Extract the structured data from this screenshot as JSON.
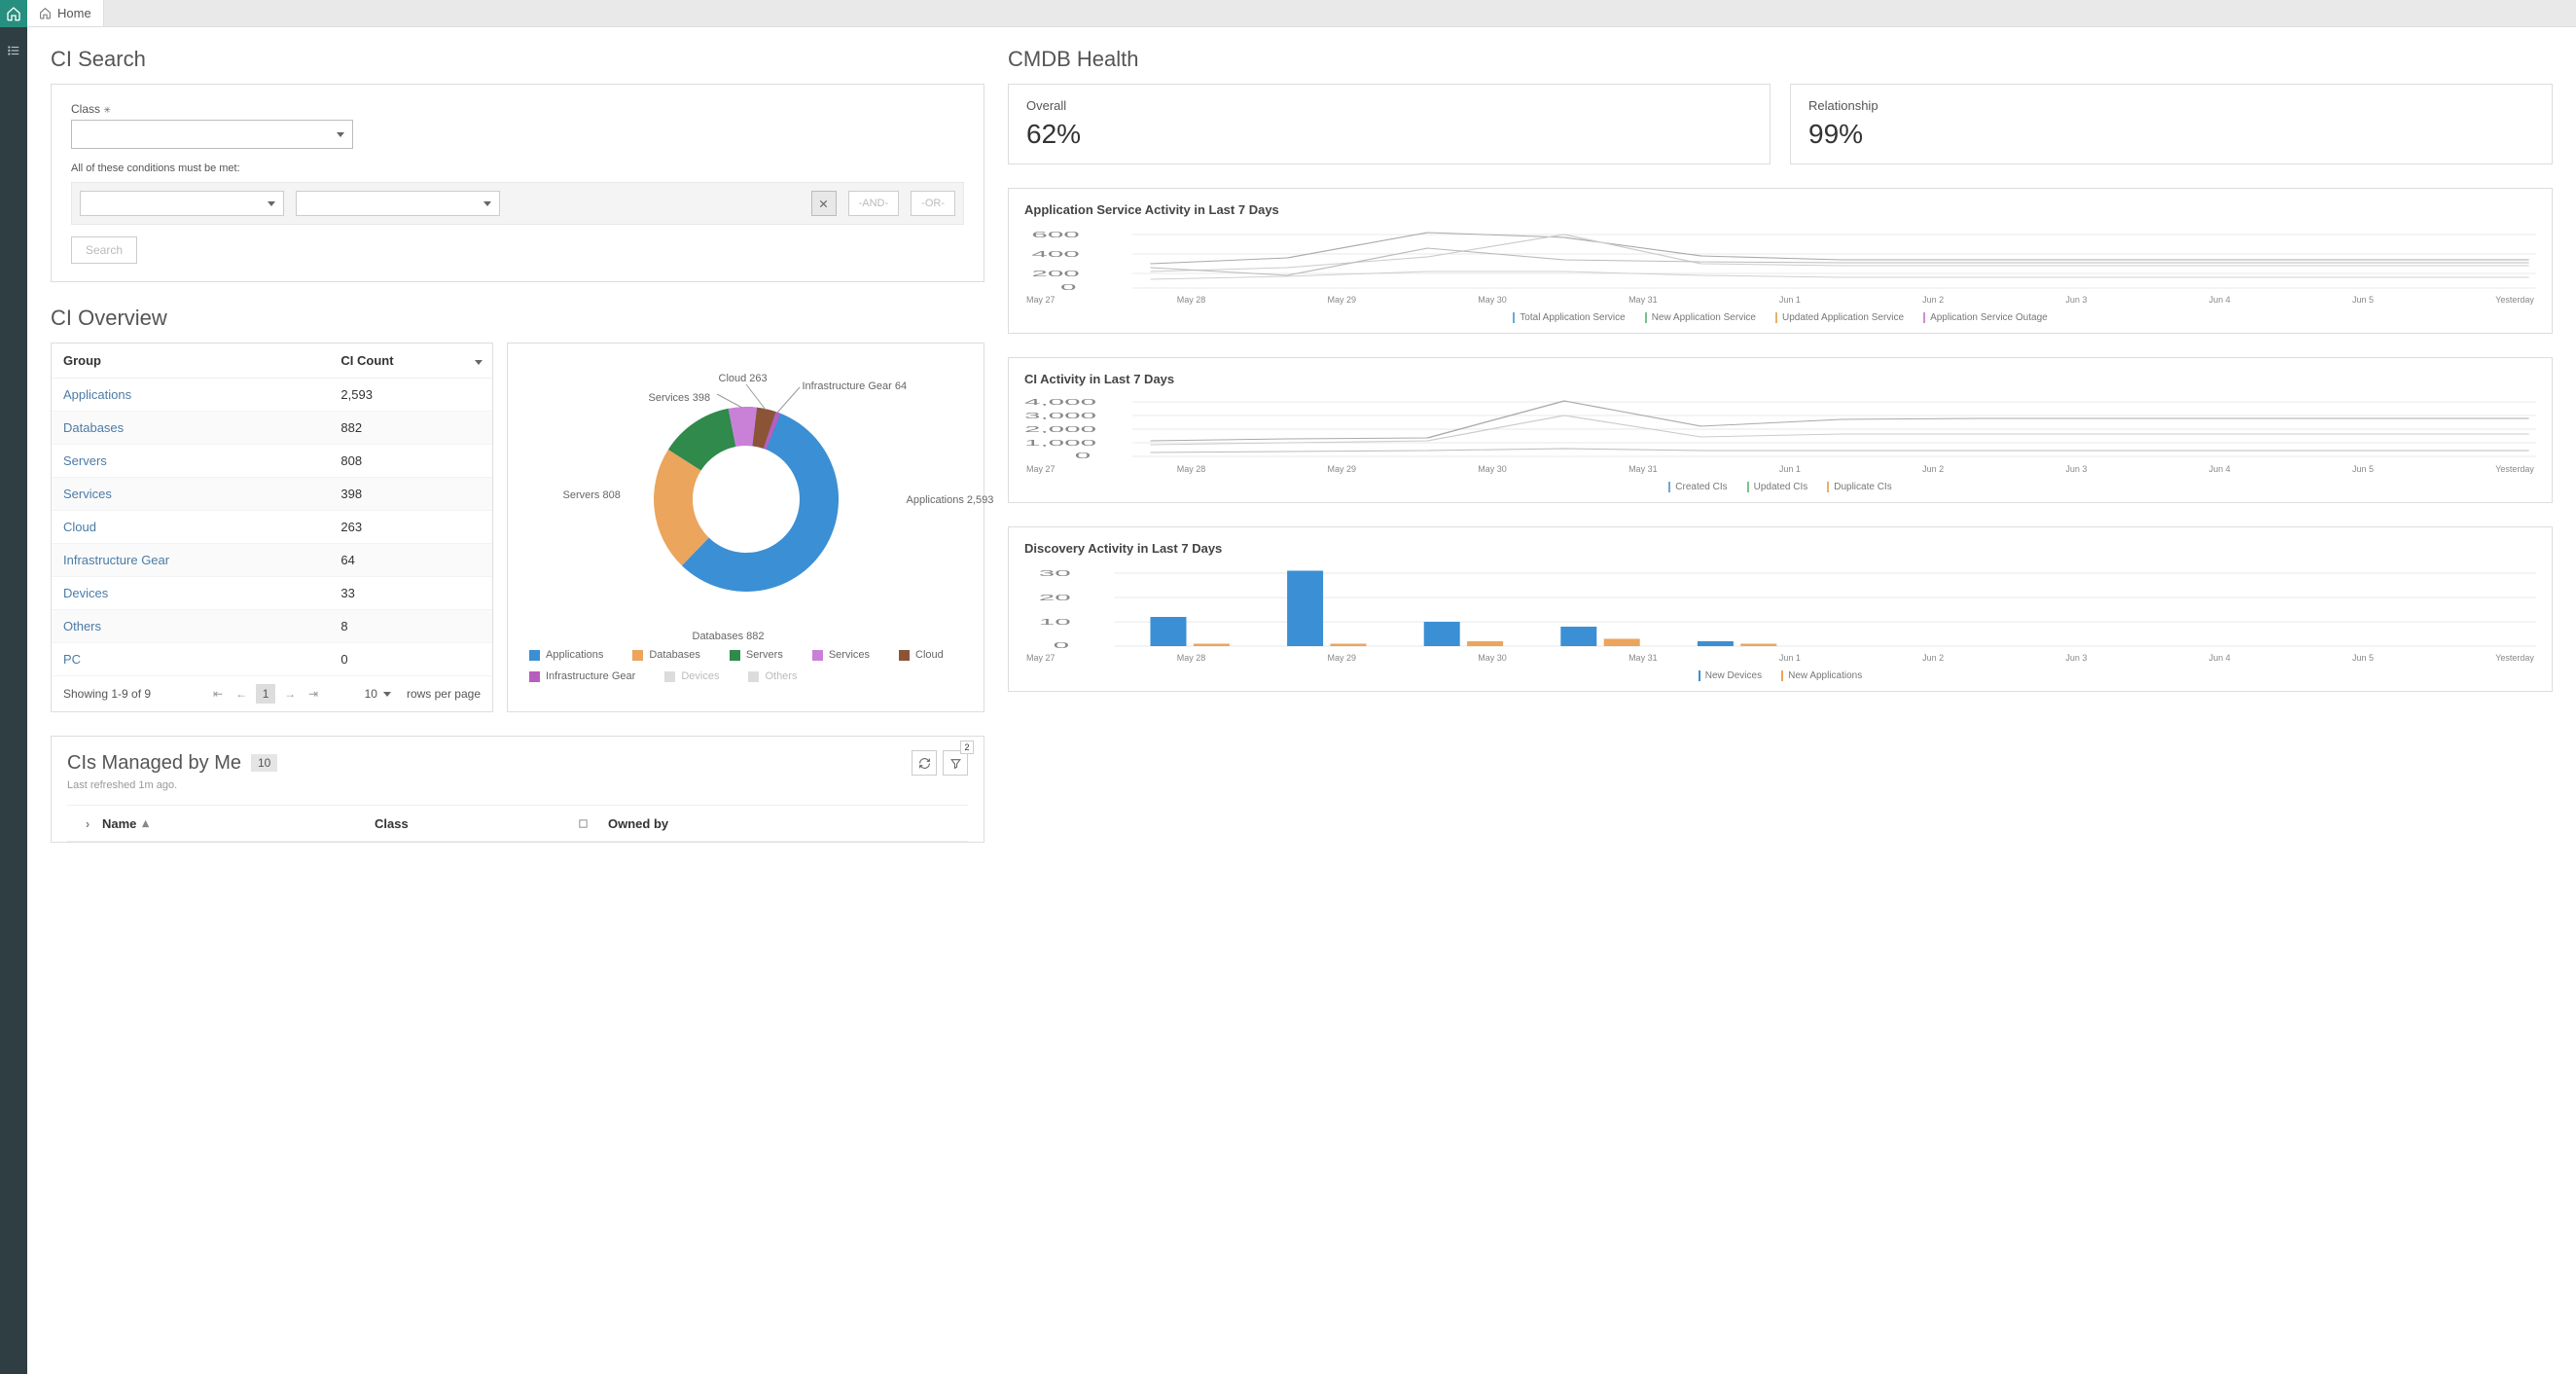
{
  "tab": {
    "label": "Home"
  },
  "ci_search": {
    "title": "CI Search",
    "class_label": "Class",
    "required_mark": "✳",
    "conditions_text": "All of these conditions must be met:",
    "and_label": "-AND-",
    "or_label": "-OR-",
    "search_label": "Search"
  },
  "ci_overview": {
    "title": "CI Overview",
    "col_group": "Group",
    "col_count": "CI Count",
    "rows": [
      {
        "group": "Applications",
        "count": "2,593"
      },
      {
        "group": "Databases",
        "count": "882"
      },
      {
        "group": "Servers",
        "count": "808"
      },
      {
        "group": "Services",
        "count": "398"
      },
      {
        "group": "Cloud",
        "count": "263"
      },
      {
        "group": "Infrastructure Gear",
        "count": "64"
      },
      {
        "group": "Devices",
        "count": "33"
      },
      {
        "group": "Others",
        "count": "8"
      },
      {
        "group": "PC",
        "count": "0"
      }
    ],
    "showing": "Showing 1-9 of 9",
    "page": "1",
    "rpp_val": "10",
    "rpp_label": "rows per page",
    "donut_labels": {
      "applications": "Applications  2,593",
      "databases": "Databases  882",
      "servers": "Servers  808",
      "services": "Services  398",
      "cloud": "Cloud  263",
      "infra": "Infrastructure Gear  64"
    },
    "legend": [
      {
        "label": "Applications",
        "color": "#3b8fd4"
      },
      {
        "label": "Databases",
        "color": "#eba55c"
      },
      {
        "label": "Servers",
        "color": "#2f8a4c"
      },
      {
        "label": "Services",
        "color": "#c981d8"
      },
      {
        "label": "Cloud",
        "color": "#8c5437"
      },
      {
        "label": "Infrastructure Gear",
        "color": "#b65fbf"
      },
      {
        "label": "Devices",
        "color": "#dcdcdc"
      },
      {
        "label": "Others",
        "color": "#dcdcdc"
      }
    ]
  },
  "managed": {
    "title": "CIs Managed by Me",
    "count": "10",
    "refreshed": "Last refreshed 1m ago.",
    "filter_badge": "2",
    "col_name": "Name",
    "col_class": "Class",
    "col_owned": "Owned by"
  },
  "health": {
    "title": "CMDB Health",
    "overall_label": "Overall",
    "overall_val": "62%",
    "rel_label": "Relationship",
    "rel_val": "99%"
  },
  "app_activity": {
    "title": "Application Service Activity in Last 7 Days",
    "legend": [
      "Total Application Service",
      "New Application Service",
      "Updated Application Service",
      "Application Service Outage"
    ]
  },
  "ci_activity": {
    "title": "CI Activity in Last 7 Days",
    "legend": [
      "Created CIs",
      "Updated CIs",
      "Duplicate CIs"
    ]
  },
  "discovery": {
    "title": "Discovery Activity in Last 7 Days",
    "legend": [
      "New Devices",
      "New Applications"
    ]
  },
  "xaxis": [
    "May 27",
    "May 28",
    "May 29",
    "May 30",
    "May 31",
    "Jun 1",
    "Jun 2",
    "Jun 3",
    "Jun 4",
    "Jun 5",
    "Yesterday"
  ],
  "chart_data": [
    {
      "type": "pie",
      "title": "CI Overview",
      "series": [
        {
          "name": "Applications",
          "value": 2593
        },
        {
          "name": "Databases",
          "value": 882
        },
        {
          "name": "Servers",
          "value": 808
        },
        {
          "name": "Services",
          "value": 398
        },
        {
          "name": "Cloud",
          "value": 263
        },
        {
          "name": "Infrastructure Gear",
          "value": 64
        },
        {
          "name": "Devices",
          "value": 33
        },
        {
          "name": "Others",
          "value": 8
        },
        {
          "name": "PC",
          "value": 0
        }
      ]
    },
    {
      "type": "line",
      "title": "Application Service Activity in Last 7 Days",
      "x": [
        "May 27",
        "May 28",
        "May 29",
        "May 30",
        "May 31",
        "Jun 1",
        "Jun 2",
        "Jun 3",
        "Jun 4",
        "Jun 5",
        "Yesterday"
      ],
      "ylim": [
        0,
        600
      ],
      "series": [
        {
          "name": "Total Application Service",
          "values": [
            300,
            360,
            640,
            590,
            380,
            330,
            330,
            330,
            330,
            330,
            330
          ]
        },
        {
          "name": "New Application Service",
          "values": [
            200,
            250,
            350,
            620,
            300,
            280,
            280,
            280,
            280,
            280,
            280
          ]
        },
        {
          "name": "Updated Application Service",
          "values": [
            260,
            150,
            470,
            320,
            310,
            300,
            300,
            300,
            300,
            300,
            300
          ]
        },
        {
          "name": "Application Service Outage",
          "values": [
            100,
            140,
            200,
            200,
            150,
            120,
            120,
            120,
            120,
            120,
            120
          ]
        }
      ]
    },
    {
      "type": "line",
      "title": "CI Activity in Last 7 Days",
      "x": [
        "May 27",
        "May 28",
        "May 29",
        "May 30",
        "May 31",
        "Jun 1",
        "Jun 2",
        "Jun 3",
        "Jun 4",
        "Jun 5",
        "Yesterday"
      ],
      "ylim": [
        0,
        4000
      ],
      "series": [
        {
          "name": "Created CIs",
          "values": [
            1200,
            1300,
            1400,
            4200,
            2300,
            2800,
            2900,
            2900,
            2900,
            2900,
            2900
          ]
        },
        {
          "name": "Updated CIs",
          "values": [
            900,
            1000,
            1200,
            3000,
            1500,
            1700,
            1700,
            1700,
            1700,
            1700,
            1700
          ]
        },
        {
          "name": "Duplicate CIs",
          "values": [
            300,
            350,
            400,
            600,
            450,
            400,
            400,
            400,
            400,
            400,
            400
          ]
        }
      ]
    },
    {
      "type": "bar",
      "title": "Discovery Activity in Last 7 Days",
      "x": [
        "May 27",
        "May 28",
        "May 29",
        "May 30",
        "May 31",
        "Jun 1",
        "Jun 2",
        "Jun 3",
        "Jun 4",
        "Jun 5",
        "Yesterday"
      ],
      "ylim": [
        0,
        30
      ],
      "series": [
        {
          "name": "New Devices",
          "values": [
            12,
            31,
            10,
            8,
            2,
            0,
            0,
            0,
            0,
            0,
            0
          ]
        },
        {
          "name": "New Applications",
          "values": [
            1,
            1,
            2,
            3,
            1,
            0,
            0,
            0,
            0,
            0,
            0
          ]
        }
      ]
    }
  ]
}
